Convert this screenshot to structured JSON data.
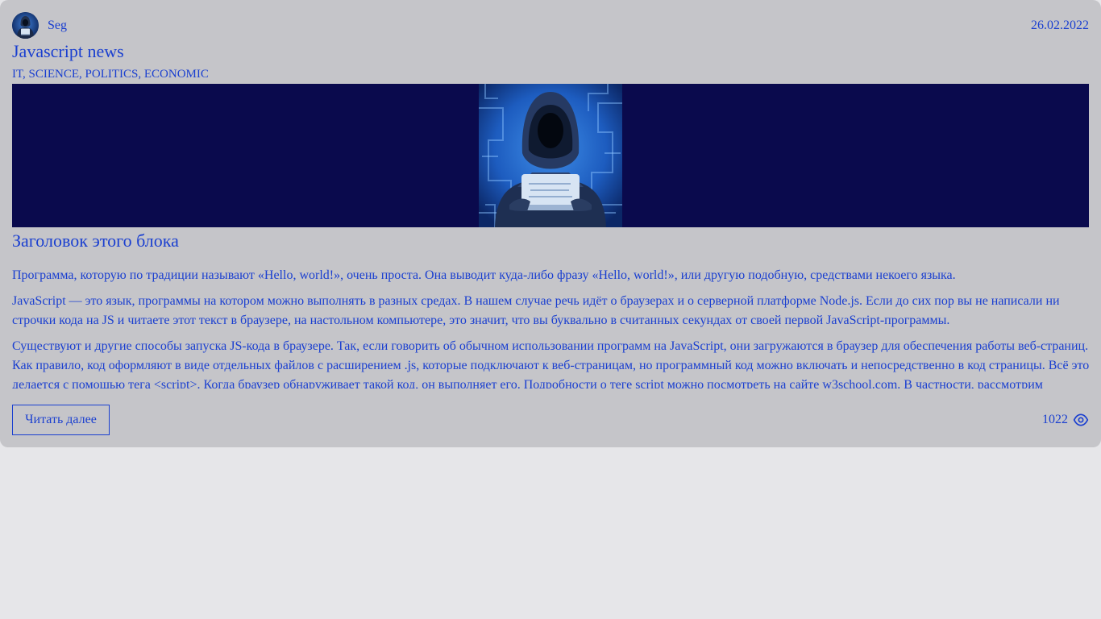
{
  "post": {
    "author": "Seg",
    "date": "26.02.2022",
    "title": "Javascript news",
    "tags": "IT, SCIENCE, POLITICS, ECONOMIC",
    "block_title": "Заголовок этого блока",
    "paragraphs": [
      "Программа, которую по традиции называют «Hello, world!», очень проста. Она выводит куда-либо фразу «Hello, world!», или другую подобную, средствами некоего языка.",
      "JavaScript — это язык, программы на котором можно выполнять в разных средах. В нашем случае речь идёт о браузерах и о серверной платформе Node.js. Если до сих пор вы не написали ни строчки кода на JS и читаете этот текст в браузере, на настольном компьютере, это значит, что вы буквально в считанных секундах от своей первой JavaScript-программы.",
      "Существуют и другие способы запуска JS-кода в браузере. Так, если говорить об обычном использовании программ на JavaScript, они загружаются в браузер для обеспечения работы веб-страниц. Как правило, код оформляют в виде отдельных файлов с расширением .js, которые подключают к веб-страницам, но программный код можно включать и непосредственно в код страницы. Всё это делается с помощью тега <script>. Когда браузер обнаруживает такой код, он выполняет его. Подробности о теге script можно посмотреть на сайте w3school.com. В частности, рассмотрим"
    ],
    "read_more_label": "Читать далее",
    "views": "1022",
    "icons": {
      "avatar": "hooded-hacker-avatar",
      "hero": "hooded-hacker-laptop-image",
      "views": "eye-icon"
    }
  },
  "colors": {
    "text_accent": "#1a3fd0",
    "card_bg": "#c5c5c9",
    "page_bg": "#e6e6e9",
    "banner_bg": "#0a0a4d"
  }
}
